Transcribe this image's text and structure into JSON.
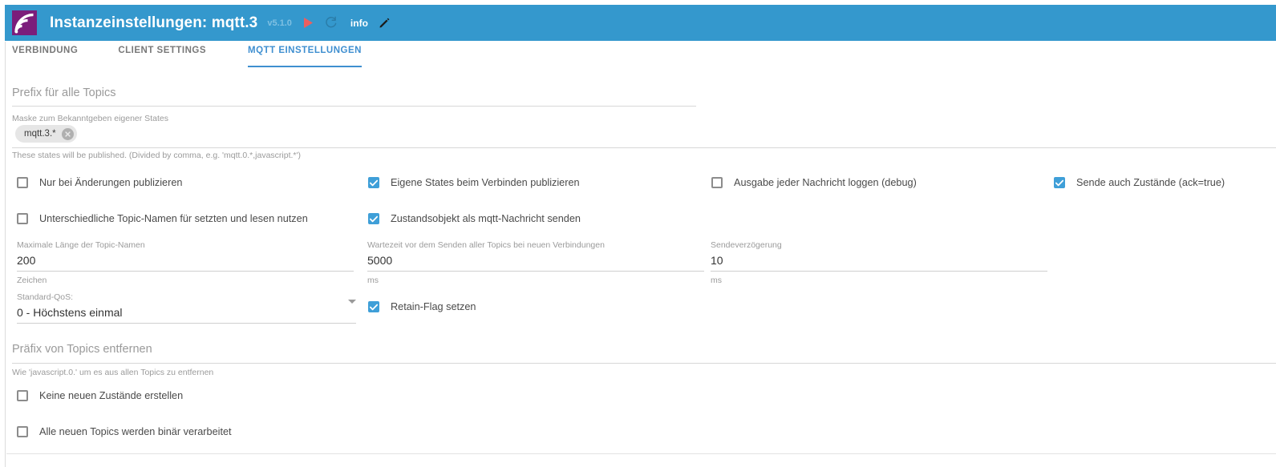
{
  "header": {
    "logo_name": "mqtt-adapter-logo",
    "title": "Instanzeinstellungen: mqtt.3",
    "version": "v5.1.0",
    "info_label": "info",
    "bg_color": "#3498cd",
    "logo_color": "#7b1d7b"
  },
  "tabs": [
    {
      "label": "VERBINDUNG",
      "active": false
    },
    {
      "label": "CLIENT SETTINGS",
      "active": false
    },
    {
      "label": "MQTT EINSTELLUNGEN",
      "active": true
    }
  ],
  "sections": {
    "prefix": {
      "heading": "Prefix für alle Topics",
      "mask_label": "Maske zum Bekanntgeben eigener States",
      "chip_value": "mqtt.3.*",
      "helper": "These states will be published. (Divided by comma, e.g. 'mqtt.0.*,javascript.*')"
    },
    "remove_prefix": {
      "heading": "Präfix von Topics entfernen",
      "helper": "Wie 'javascript.0.' um es aus allen Topics zu entfernen"
    }
  },
  "checkboxes": {
    "publish_only_on_change": {
      "label": "Nur bei Änderungen publizieren",
      "checked": false
    },
    "publish_own_states_on_connect": {
      "label": "Eigene States beim Verbinden publizieren",
      "checked": true
    },
    "log_every_message": {
      "label": "Ausgabe jeder Nachricht loggen (debug)",
      "checked": false
    },
    "send_ack_states": {
      "label": "Sende auch Zustände (ack=true)",
      "checked": true
    },
    "different_topic_names": {
      "label": "Unterschiedliche Topic-Namen für setzten und lesen nutzen",
      "checked": false
    },
    "state_object_as_message": {
      "label": "Zustandsobjekt als mqtt-Nachricht senden",
      "checked": true
    },
    "set_retain_flag": {
      "label": "Retain-Flag setzen",
      "checked": true
    },
    "no_new_states": {
      "label": "Keine neuen Zustände erstellen",
      "checked": false
    },
    "all_topics_binary": {
      "label": "Alle neuen Topics werden binär verarbeitet",
      "checked": false
    }
  },
  "fields": {
    "max_topic_length": {
      "label": "Maximale Länge der Topic-Namen",
      "value": "200",
      "unit": "Zeichen"
    },
    "wait_before_send": {
      "label": "Wartezeit vor dem Senden aller Topics bei neuen Verbindungen",
      "value": "5000",
      "unit": "ms"
    },
    "send_delay": {
      "label": "Sendeverzögerung",
      "value": "10",
      "unit": "ms"
    },
    "default_qos": {
      "label": "Standard-QoS:",
      "value": "0 - Höchstens einmal"
    }
  }
}
